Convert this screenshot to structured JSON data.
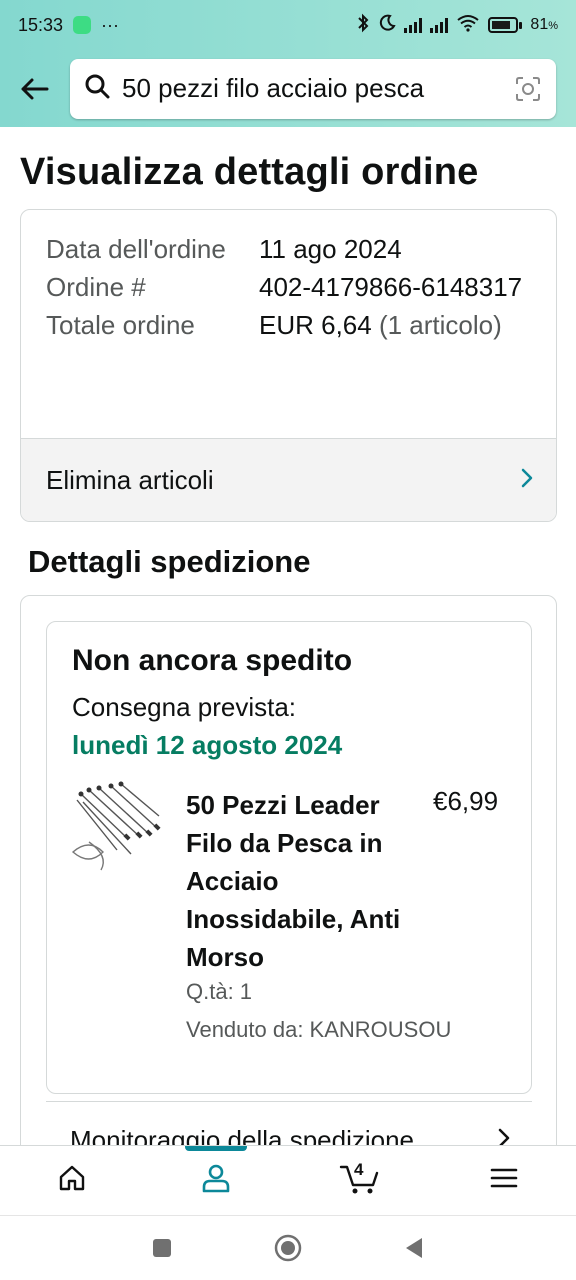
{
  "status_bar": {
    "time": "15:33",
    "dots": "···",
    "battery": "81"
  },
  "search": {
    "query": "50 pezzi filo acciaio pesca"
  },
  "page": {
    "title": "Visualizza dettagli ordine"
  },
  "order": {
    "date_label": "Data dell'ordine",
    "date_value": "11 ago 2024",
    "number_label": "Ordine #",
    "number_value": "402-4179866-6148317",
    "total_label": "Totale ordine",
    "total_value": "EUR 6,64",
    "total_count": "(1 articolo)",
    "remove_items_label": "Elimina articoli"
  },
  "shipping": {
    "section_title": "Dettagli spedizione",
    "status": "Non ancora spedito",
    "eta_label": "Consegna prevista:",
    "eta_date": "lunedì 12 agosto 2024",
    "tracking_label": "Monitoraggio della spedizione"
  },
  "product": {
    "title": "50 Pezzi Leader Filo da Pesca in Acciaio Inossidabile, Anti Morso",
    "price": "€6,99",
    "qty": "Q.tà: 1",
    "seller": "Venduto da: KANROUSOU"
  },
  "bottom_nav": {
    "cart_count": "4",
    "active_tab": "account"
  },
  "colors": {
    "header_bg": "#84d8cf",
    "accent": "#0c8899",
    "delivery_green": "#067d62",
    "link_chevron": "#0c8899"
  }
}
